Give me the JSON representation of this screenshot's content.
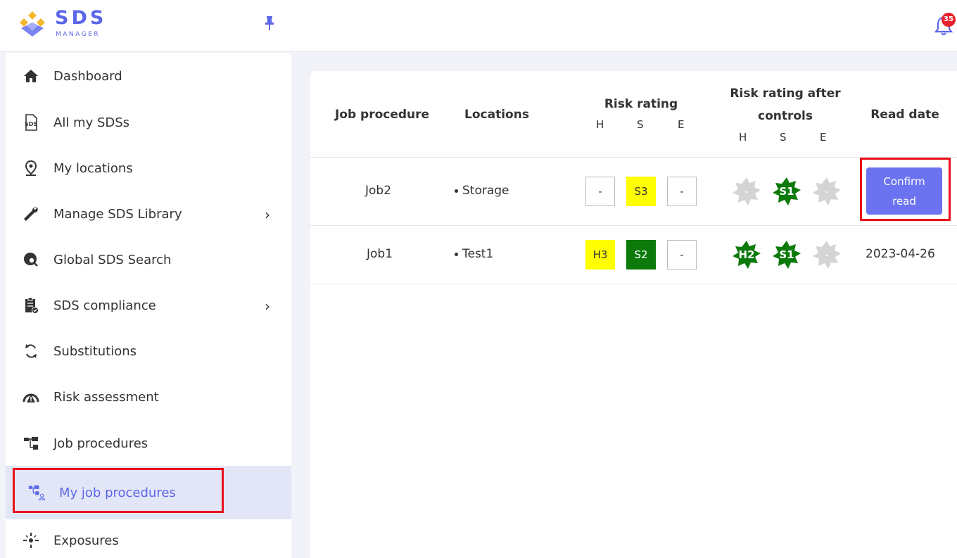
{
  "logo": {
    "text": "SDS",
    "sub": "MANAGER"
  },
  "notifications": {
    "count": "35"
  },
  "sidebar": {
    "items": [
      {
        "label": "Dashboard",
        "icon": "home-icon"
      },
      {
        "label": "All my SDSs",
        "icon": "sds-doc-icon"
      },
      {
        "label": "My locations",
        "icon": "location-pin-icon"
      },
      {
        "label": "Manage SDS Library",
        "icon": "wrench-icon",
        "chevron": "›"
      },
      {
        "label": "Global SDS Search",
        "icon": "globe-search-icon"
      },
      {
        "label": "SDS compliance",
        "icon": "clipboard-check-icon",
        "chevron": "›"
      },
      {
        "label": "Substitutions",
        "icon": "refresh-arrows-icon"
      },
      {
        "label": "Risk assessment",
        "icon": "gauge-warning-icon"
      },
      {
        "label": "Job procedures",
        "icon": "hierarchy-icon"
      },
      {
        "label": "My job procedures",
        "icon": "hierarchy-user-icon"
      },
      {
        "label": "Exposures",
        "icon": "exposure-icon"
      }
    ]
  },
  "table": {
    "headers": {
      "job_procedure": "Job procedure",
      "locations": "Locations",
      "risk_rating": "Risk rating",
      "risk_after_line1": "Risk rating after",
      "risk_after_line2": "controls",
      "read_date": "Read date",
      "h": "H",
      "s": "S",
      "e": "E"
    },
    "rows": [
      {
        "job": "Job2",
        "location": "Storage",
        "risk": [
          "-",
          "S3",
          "-"
        ],
        "after": [
          "-",
          "S1",
          "-"
        ],
        "read": "Confirm\nread"
      },
      {
        "job": "Job1",
        "location": "Test1",
        "risk": [
          "H3",
          "S2",
          "-"
        ],
        "after": [
          "H2",
          "S1",
          "-"
        ],
        "read": "2023-04-26"
      }
    ]
  },
  "colors": {
    "accent": "#5b66e8",
    "yellow": "#ffff00",
    "green": "#0b7a0b",
    "grey": "#d4d4d4",
    "highlight": "#e8101c"
  }
}
